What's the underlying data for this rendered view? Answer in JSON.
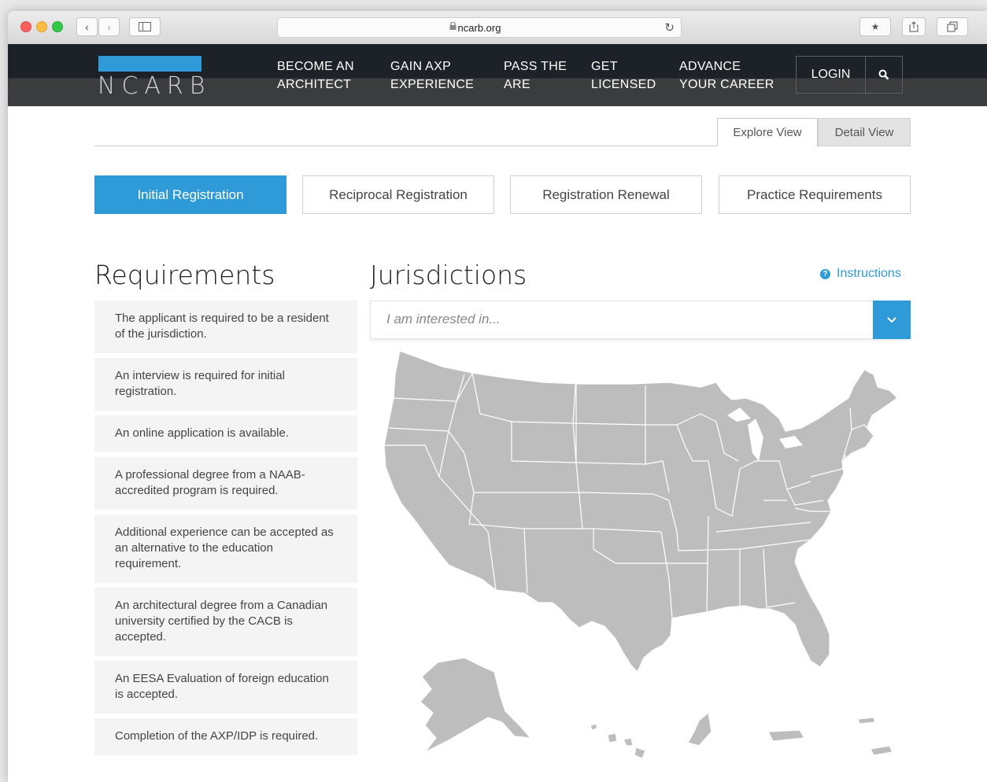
{
  "browser": {
    "url": "ncarb.org"
  },
  "site": {
    "logo_text": "NCARB",
    "nav": [
      {
        "line1": "BECOME AN",
        "line2": "ARCHITECT"
      },
      {
        "line1": "GAIN AXP",
        "line2": "EXPERIENCE"
      },
      {
        "line1": "PASS THE",
        "line2": "ARE"
      },
      {
        "line1": "GET",
        "line2": "LICENSED"
      },
      {
        "line1": "ADVANCE",
        "line2": "YOUR CAREER"
      }
    ],
    "login_label": "LOGIN",
    "search_icon": "search-icon"
  },
  "view_toggle": {
    "explore": "Explore View",
    "detail": "Detail View",
    "active": "Explore View"
  },
  "registration_tabs": [
    {
      "label": "Initial Registration",
      "active": true
    },
    {
      "label": "Reciprocal Registration",
      "active": false
    },
    {
      "label": "Registration Renewal",
      "active": false
    },
    {
      "label": "Practice Requirements",
      "active": false
    }
  ],
  "requirements": {
    "title": "Requirements",
    "items": [
      "The applicant is required to be a resident of the jurisdiction.",
      "An interview is required for initial registration.",
      "An online application is available.",
      "A professional degree from a NAAB-accredited program is required.",
      "Additional experience can be accepted as an alternative to the education requirement.",
      "An architectural degree from a Canadian university certified by the CACB is accepted.",
      "An EESA Evaluation of foreign education is accepted.",
      "Completion of the AXP/IDP is required."
    ]
  },
  "jurisdictions": {
    "title": "Jurisdictions",
    "instructions_label": "Instructions",
    "select_placeholder": "I am interested in..."
  },
  "colors": {
    "accent": "#2e9ad8",
    "nav_bg": "#1d2228",
    "map_fill": "#bdbdbe",
    "map_stroke": "#ffffff"
  }
}
